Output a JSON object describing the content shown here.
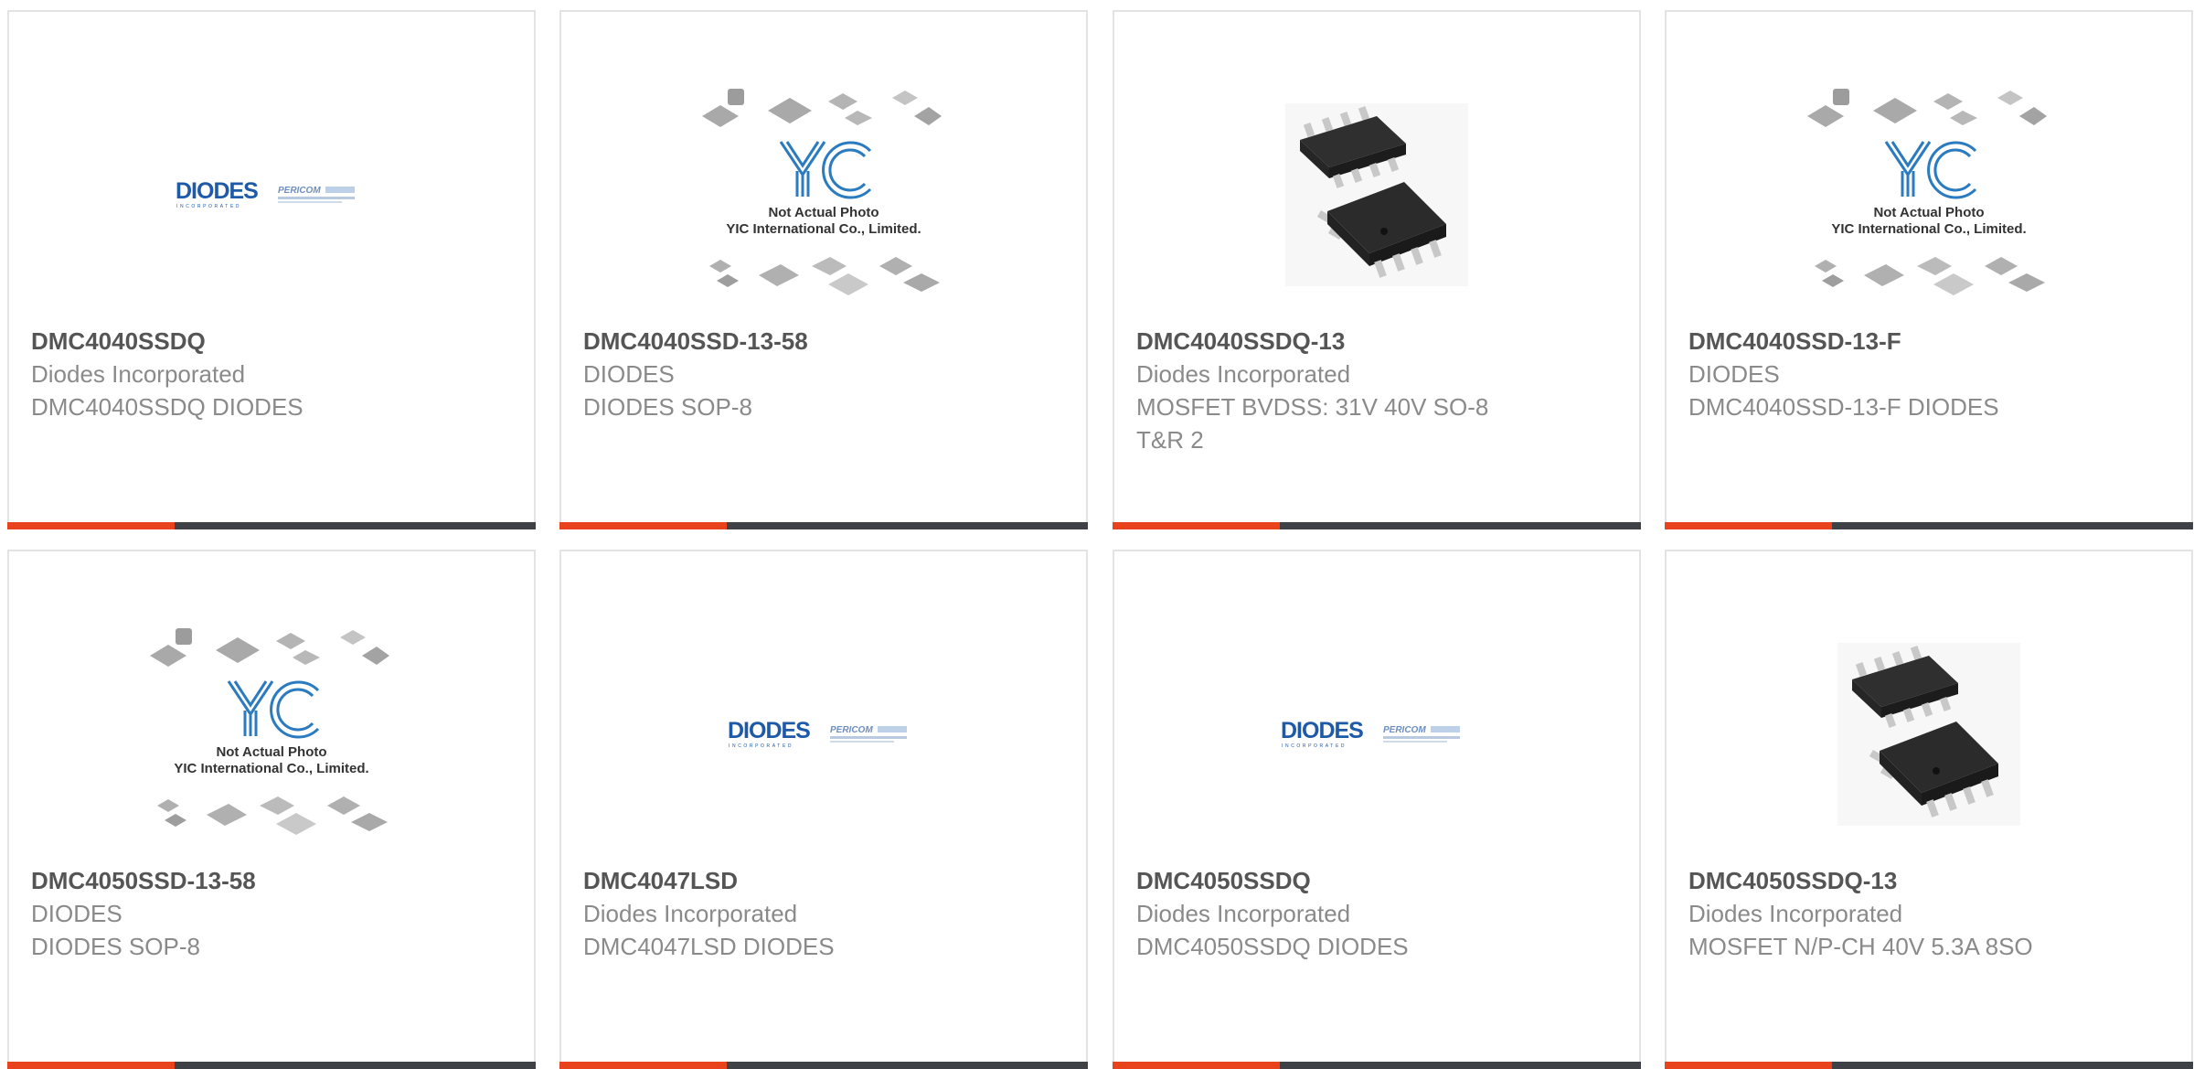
{
  "colors": {
    "accent": "#e8431c",
    "bar_dark": "#3e4246",
    "card_border": "#e3e3e3",
    "title": "#555555",
    "meta": "#8a8a8a",
    "logo_blue": "#1e5aa8",
    "yic_blue": "#2a7bc0"
  },
  "logos": {
    "diodes_wordmark": "DIODES",
    "diodes_tagline": "INCORPORATED",
    "pericom_wordmark": "PERICOM",
    "yic_wordmark": "YIC",
    "yic_caption_1": "Not Actual Photo",
    "yic_caption_2": "YIC International Co., Limited."
  },
  "products": [
    {
      "part": "DMC4040SSDQ",
      "manufacturer": "Diodes Incorporated",
      "description": "DMC4040SSDQ DIODES",
      "image": "diodes-logo"
    },
    {
      "part": "DMC4040SSD-13-58",
      "manufacturer": "DIODES",
      "description": "DIODES SOP-8",
      "image": "yic-placeholder"
    },
    {
      "part": "DMC4040SSDQ-13",
      "manufacturer": "Diodes Incorporated",
      "description": "MOSFET BVDSS: 31V 40V SO-8 T&R 2",
      "image": "so8-chip"
    },
    {
      "part": "DMC4040SSD-13-F",
      "manufacturer": "DIODES",
      "description": "DMC4040SSD-13-F DIODES",
      "image": "yic-placeholder"
    },
    {
      "part": "DMC4050SSD-13-58",
      "manufacturer": "DIODES",
      "description": "DIODES SOP-8",
      "image": "yic-placeholder"
    },
    {
      "part": "DMC4047LSD",
      "manufacturer": "Diodes Incorporated",
      "description": "DMC4047LSD DIODES",
      "image": "diodes-logo"
    },
    {
      "part": "DMC4050SSDQ",
      "manufacturer": "Diodes Incorporated",
      "description": "DMC4050SSDQ DIODES",
      "image": "diodes-logo"
    },
    {
      "part": "DMC4050SSDQ-13",
      "manufacturer": "Diodes Incorporated",
      "description": "MOSFET N/P-CH 40V 5.3A 8SO",
      "image": "so8-chip"
    }
  ]
}
